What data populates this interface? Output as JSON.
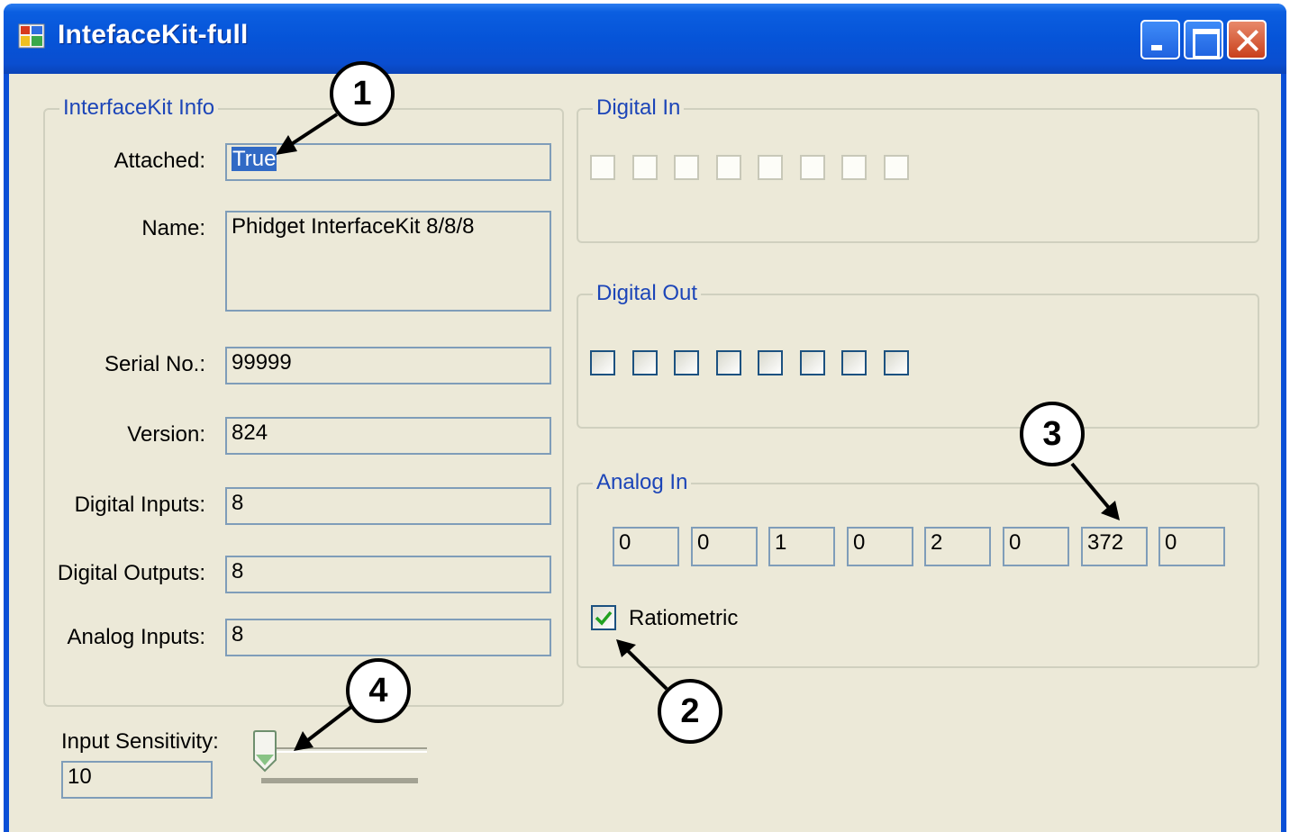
{
  "window": {
    "title": "IntefaceKit-full"
  },
  "info_group": {
    "title": "InterfaceKit Info",
    "fields": [
      {
        "label": "Attached:",
        "value": "True"
      },
      {
        "label": "Name:",
        "value": "Phidget InterfaceKit 8/8/8"
      },
      {
        "label": "Serial No.:",
        "value": "99999"
      },
      {
        "label": "Version:",
        "value": "824"
      },
      {
        "label": "Digital Inputs:",
        "value": "8"
      },
      {
        "label": "Digital Outputs:",
        "value": "8"
      },
      {
        "label": "Analog Inputs:",
        "value": "8"
      }
    ]
  },
  "sensitivity": {
    "label": "Input Sensitivity:",
    "value": "10"
  },
  "digital_in": {
    "title": "Digital In",
    "count": 8
  },
  "digital_out": {
    "title": "Digital Out",
    "count": 8
  },
  "analog_in": {
    "title": "Analog In",
    "values": [
      "0",
      "0",
      "1",
      "0",
      "2",
      "0",
      "372",
      "0"
    ],
    "ratiometric_label": "Ratiometric",
    "ratiometric_checked": true
  },
  "callouts": [
    "1",
    "2",
    "3",
    "4"
  ],
  "colors": {
    "titlebar": "#0654d8",
    "client_bg": "#ece9d8",
    "group_title": "#1c45b8",
    "selection": "#316ac5",
    "textbox_border": "#7f9db9"
  }
}
